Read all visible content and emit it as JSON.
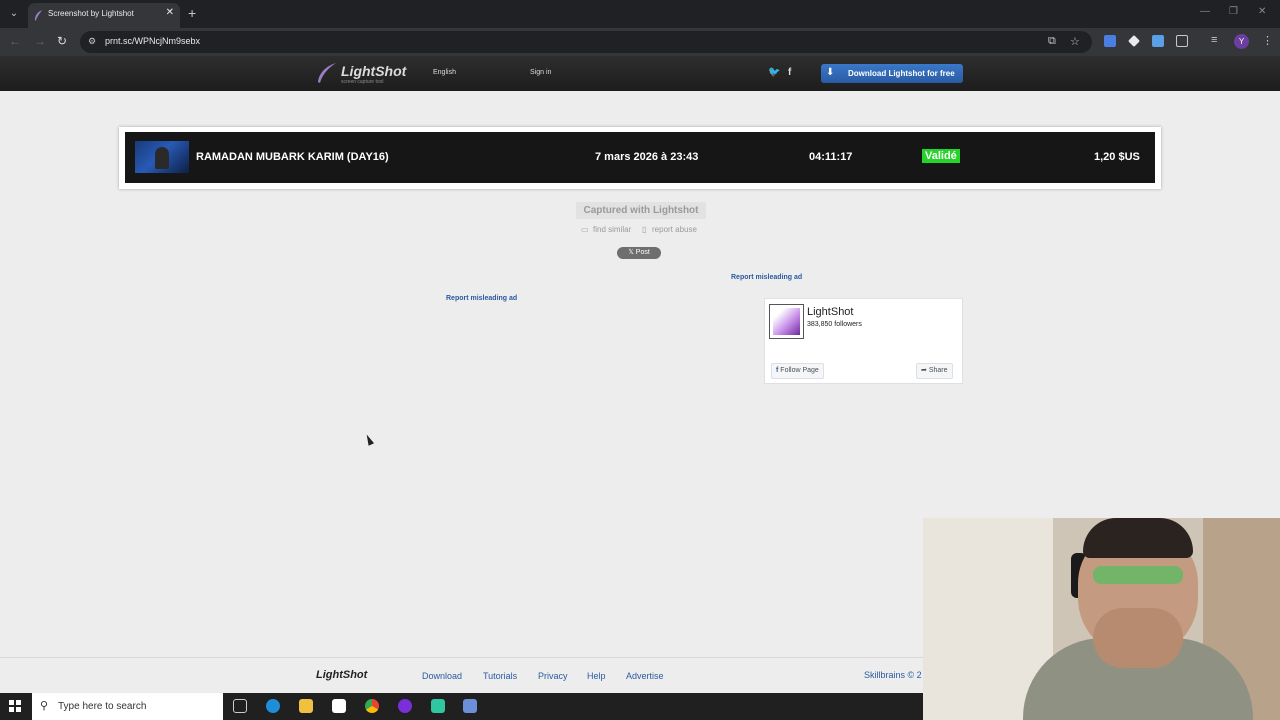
{
  "browser": {
    "tab_title": "Screenshot by Lightshot",
    "tab_close": "✕",
    "new_tab": "+",
    "url": "prnt.sc/WPNcjNm9sebx",
    "profile_initial": "Y"
  },
  "header": {
    "logo_name": "LightShot",
    "logo_tagline": "screen capture tool",
    "language": "English",
    "sign_in": "Sign in",
    "twitter": "🐦",
    "facebook": "f",
    "download_label": "Download Lightshot for free"
  },
  "screenshot": {
    "title": "RAMADAN MUBARK KARIM (DAY16)",
    "date": "7 mars 2026 à 23:43",
    "duration": "04:11:17",
    "status": "Validé",
    "amount": "1,20 $US",
    "status_color": "#25d32a"
  },
  "capture": {
    "captured_label": "Captured with Lightshot",
    "find_similar": "find similar",
    "report_abuse": "report abuse",
    "post_label": "𝕏 Post",
    "report_ad_1": "Report misleading ad",
    "report_ad_2": "Report misleading ad"
  },
  "fb_widget": {
    "page_name": "LightShot",
    "followers": "383,850 followers",
    "follow_label": "Follow Page",
    "share_label": "Share"
  },
  "footer": {
    "logo": "LightShot",
    "links": [
      "Download",
      "Tutorials",
      "Privacy",
      "Help",
      "Advertise"
    ],
    "copyright": "Skillbrains © 2"
  },
  "taskbar": {
    "search_placeholder": "Type here to search"
  }
}
